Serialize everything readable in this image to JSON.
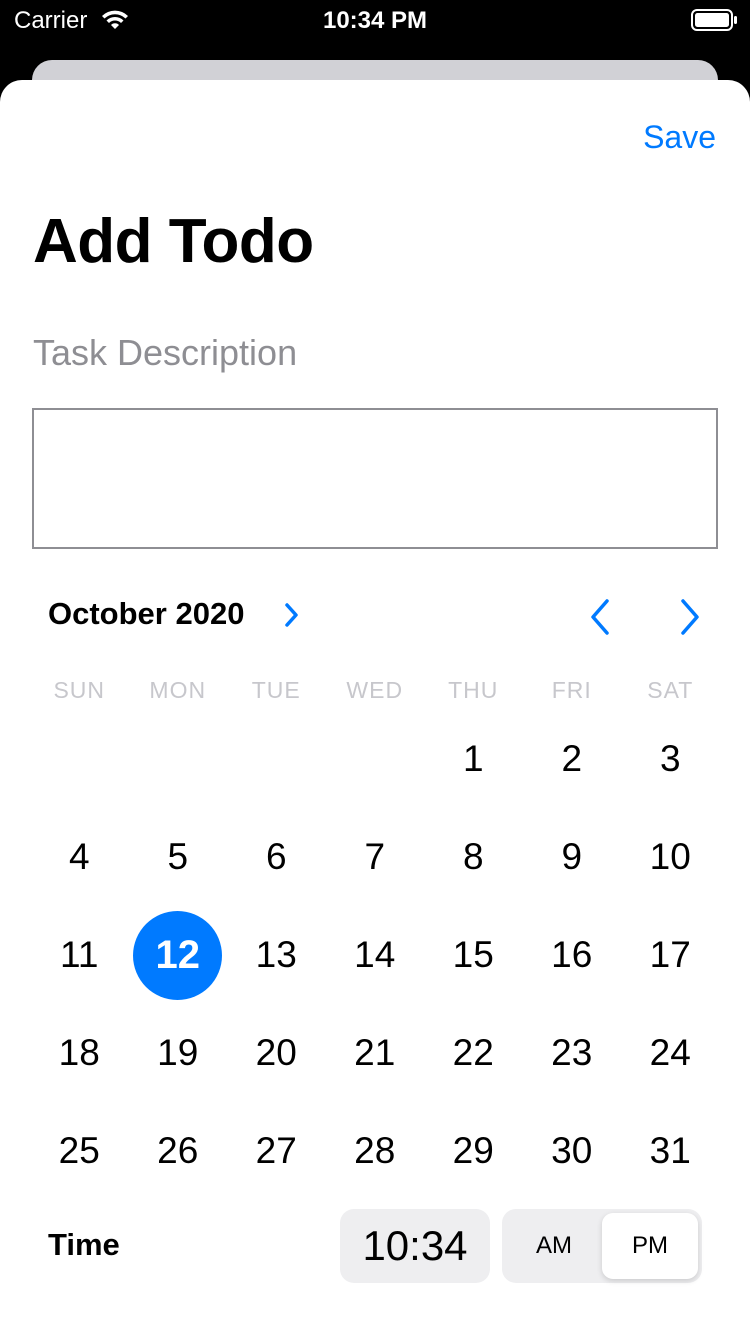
{
  "status_bar": {
    "carrier": "Carrier",
    "time": "10:34 PM"
  },
  "header": {
    "save_label": "Save",
    "title": "Add Todo"
  },
  "form": {
    "task_label": "Task Description",
    "task_value": ""
  },
  "calendar": {
    "month_label": "October 2020",
    "weekdays": [
      "SUN",
      "MON",
      "TUE",
      "WED",
      "THU",
      "FRI",
      "SAT"
    ],
    "days": [
      "",
      "",
      "",
      "",
      "1",
      "2",
      "3",
      "4",
      "5",
      "6",
      "7",
      "8",
      "9",
      "10",
      "11",
      "12",
      "13",
      "14",
      "15",
      "16",
      "17",
      "18",
      "19",
      "20",
      "21",
      "22",
      "23",
      "24",
      "25",
      "26",
      "27",
      "28",
      "29",
      "30",
      "31"
    ],
    "selected_day": "12"
  },
  "time_picker": {
    "label": "Time",
    "value": "10:34",
    "am_label": "AM",
    "pm_label": "PM",
    "selected_period": "PM"
  },
  "colors": {
    "accent": "#007aff",
    "placeholder": "#8e8e93",
    "weekday": "#c7c7cc"
  }
}
